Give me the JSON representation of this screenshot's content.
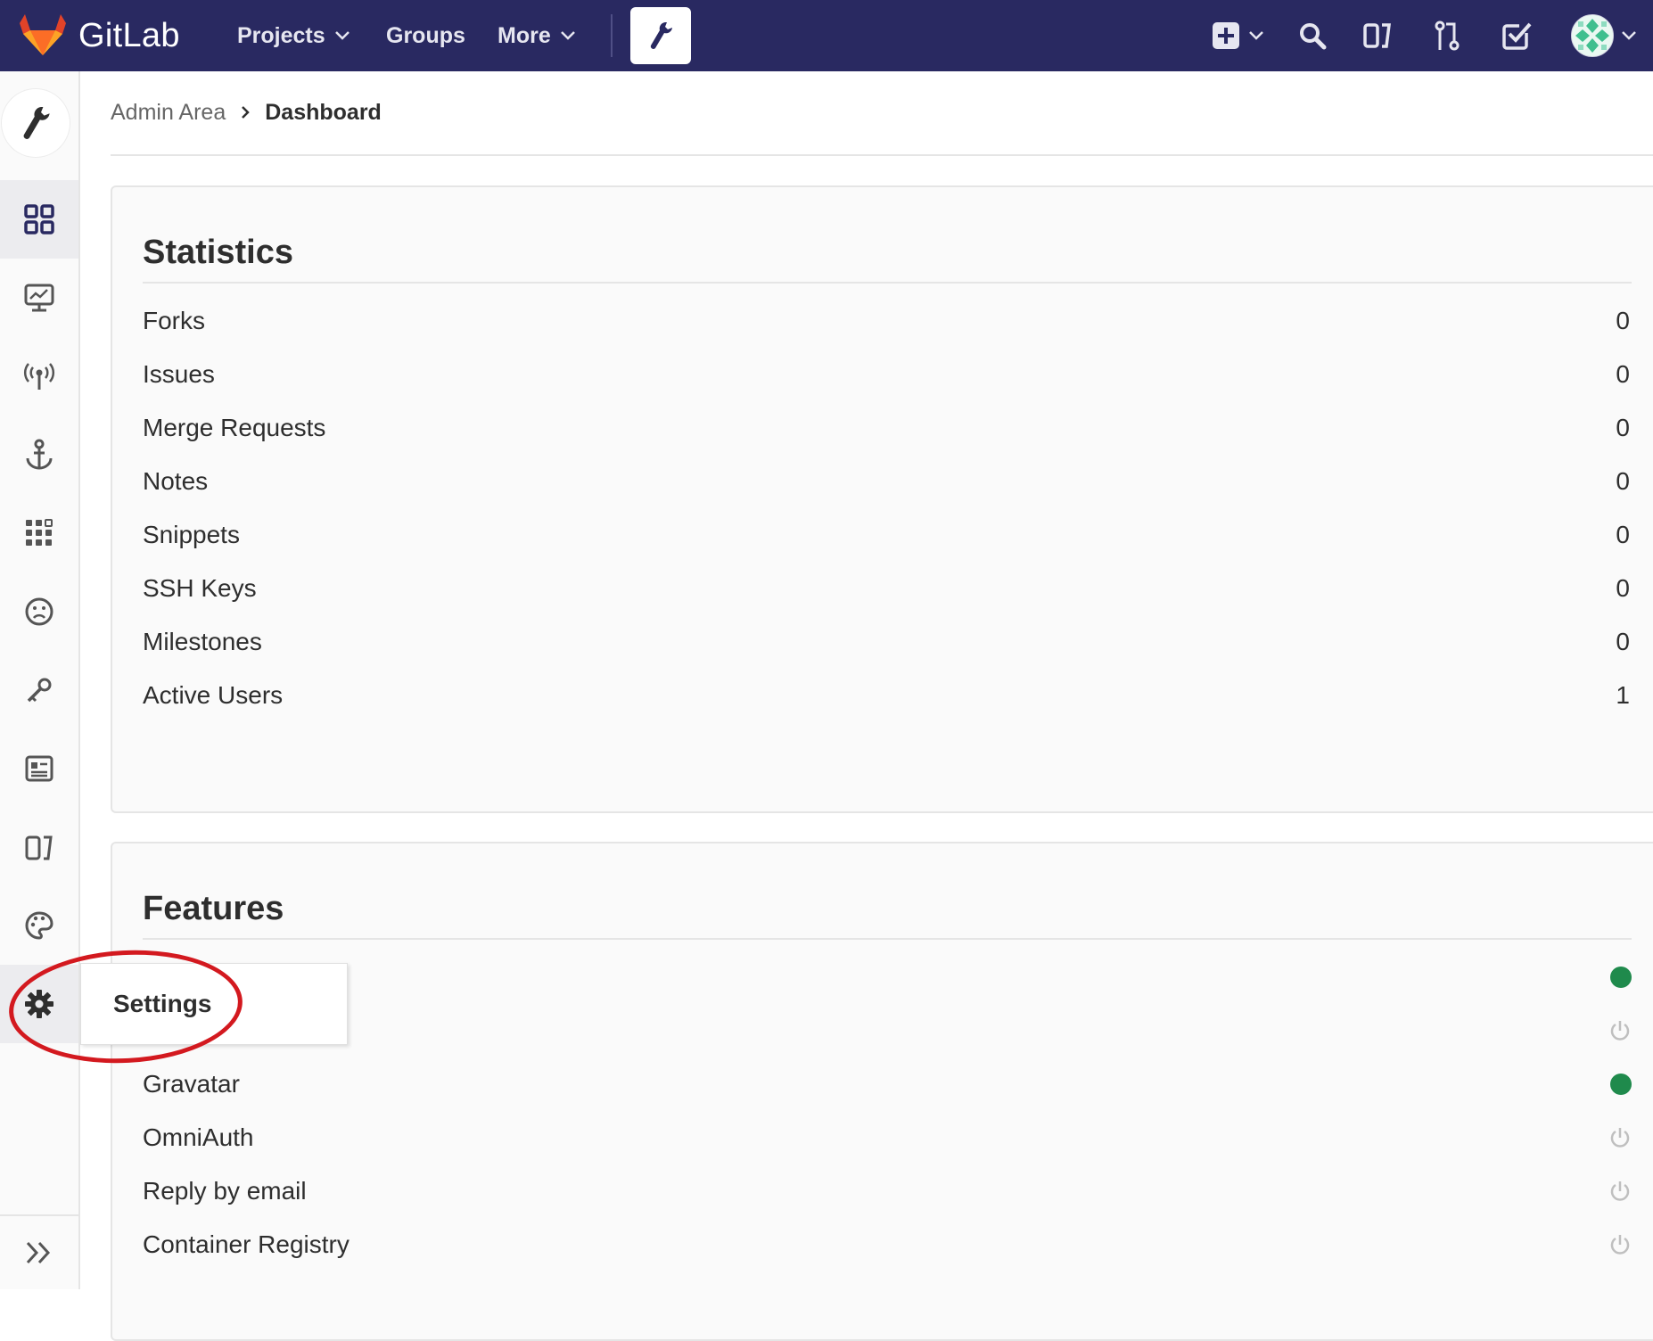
{
  "navbar": {
    "brand": "GitLab",
    "links": [
      {
        "label": "Projects",
        "has_caret": true
      },
      {
        "label": "Groups",
        "has_caret": false
      },
      {
        "label": "More",
        "has_caret": true
      }
    ],
    "bg_color": "#292961"
  },
  "sidebar": {
    "items": [
      {
        "icon": "overview-grid-icon",
        "active": true
      },
      {
        "icon": "monitoring-icon"
      },
      {
        "icon": "messages-broadcast-icon"
      },
      {
        "icon": "system-hooks-anchor-icon"
      },
      {
        "icon": "applications-icon"
      },
      {
        "icon": "abuse-reports-icon"
      },
      {
        "icon": "deploy-keys-icon"
      },
      {
        "icon": "labels-icon"
      },
      {
        "icon": "appearance-palette-icon"
      },
      {
        "icon": "settings-gear-icon",
        "hover": true
      }
    ],
    "flyout_label": "Settings"
  },
  "breadcrumb": {
    "parent": "Admin Area",
    "current": "Dashboard"
  },
  "statistics": {
    "title": "Statistics",
    "rows": [
      {
        "label": "Forks",
        "value": "0"
      },
      {
        "label": "Issues",
        "value": "0"
      },
      {
        "label": "Merge Requests",
        "value": "0"
      },
      {
        "label": "Notes",
        "value": "0"
      },
      {
        "label": "Snippets",
        "value": "0"
      },
      {
        "label": "SSH Keys",
        "value": "0"
      },
      {
        "label": "Milestones",
        "value": "0"
      },
      {
        "label": "Active Users",
        "value": "1"
      }
    ]
  },
  "features": {
    "title": "Features",
    "rows": [
      {
        "label": "",
        "status": "enabled"
      },
      {
        "label": "",
        "status": "disabled"
      },
      {
        "label": "Gravatar",
        "status": "enabled"
      },
      {
        "label": "OmniAuth",
        "status": "disabled"
      },
      {
        "label": "Reply by email",
        "status": "disabled"
      },
      {
        "label": "Container Registry",
        "status": "disabled"
      }
    ]
  },
  "colors": {
    "status_enabled": "#1f8a4c",
    "status_disabled": "#bfbfbf",
    "highlight_ring": "#d3191f"
  }
}
